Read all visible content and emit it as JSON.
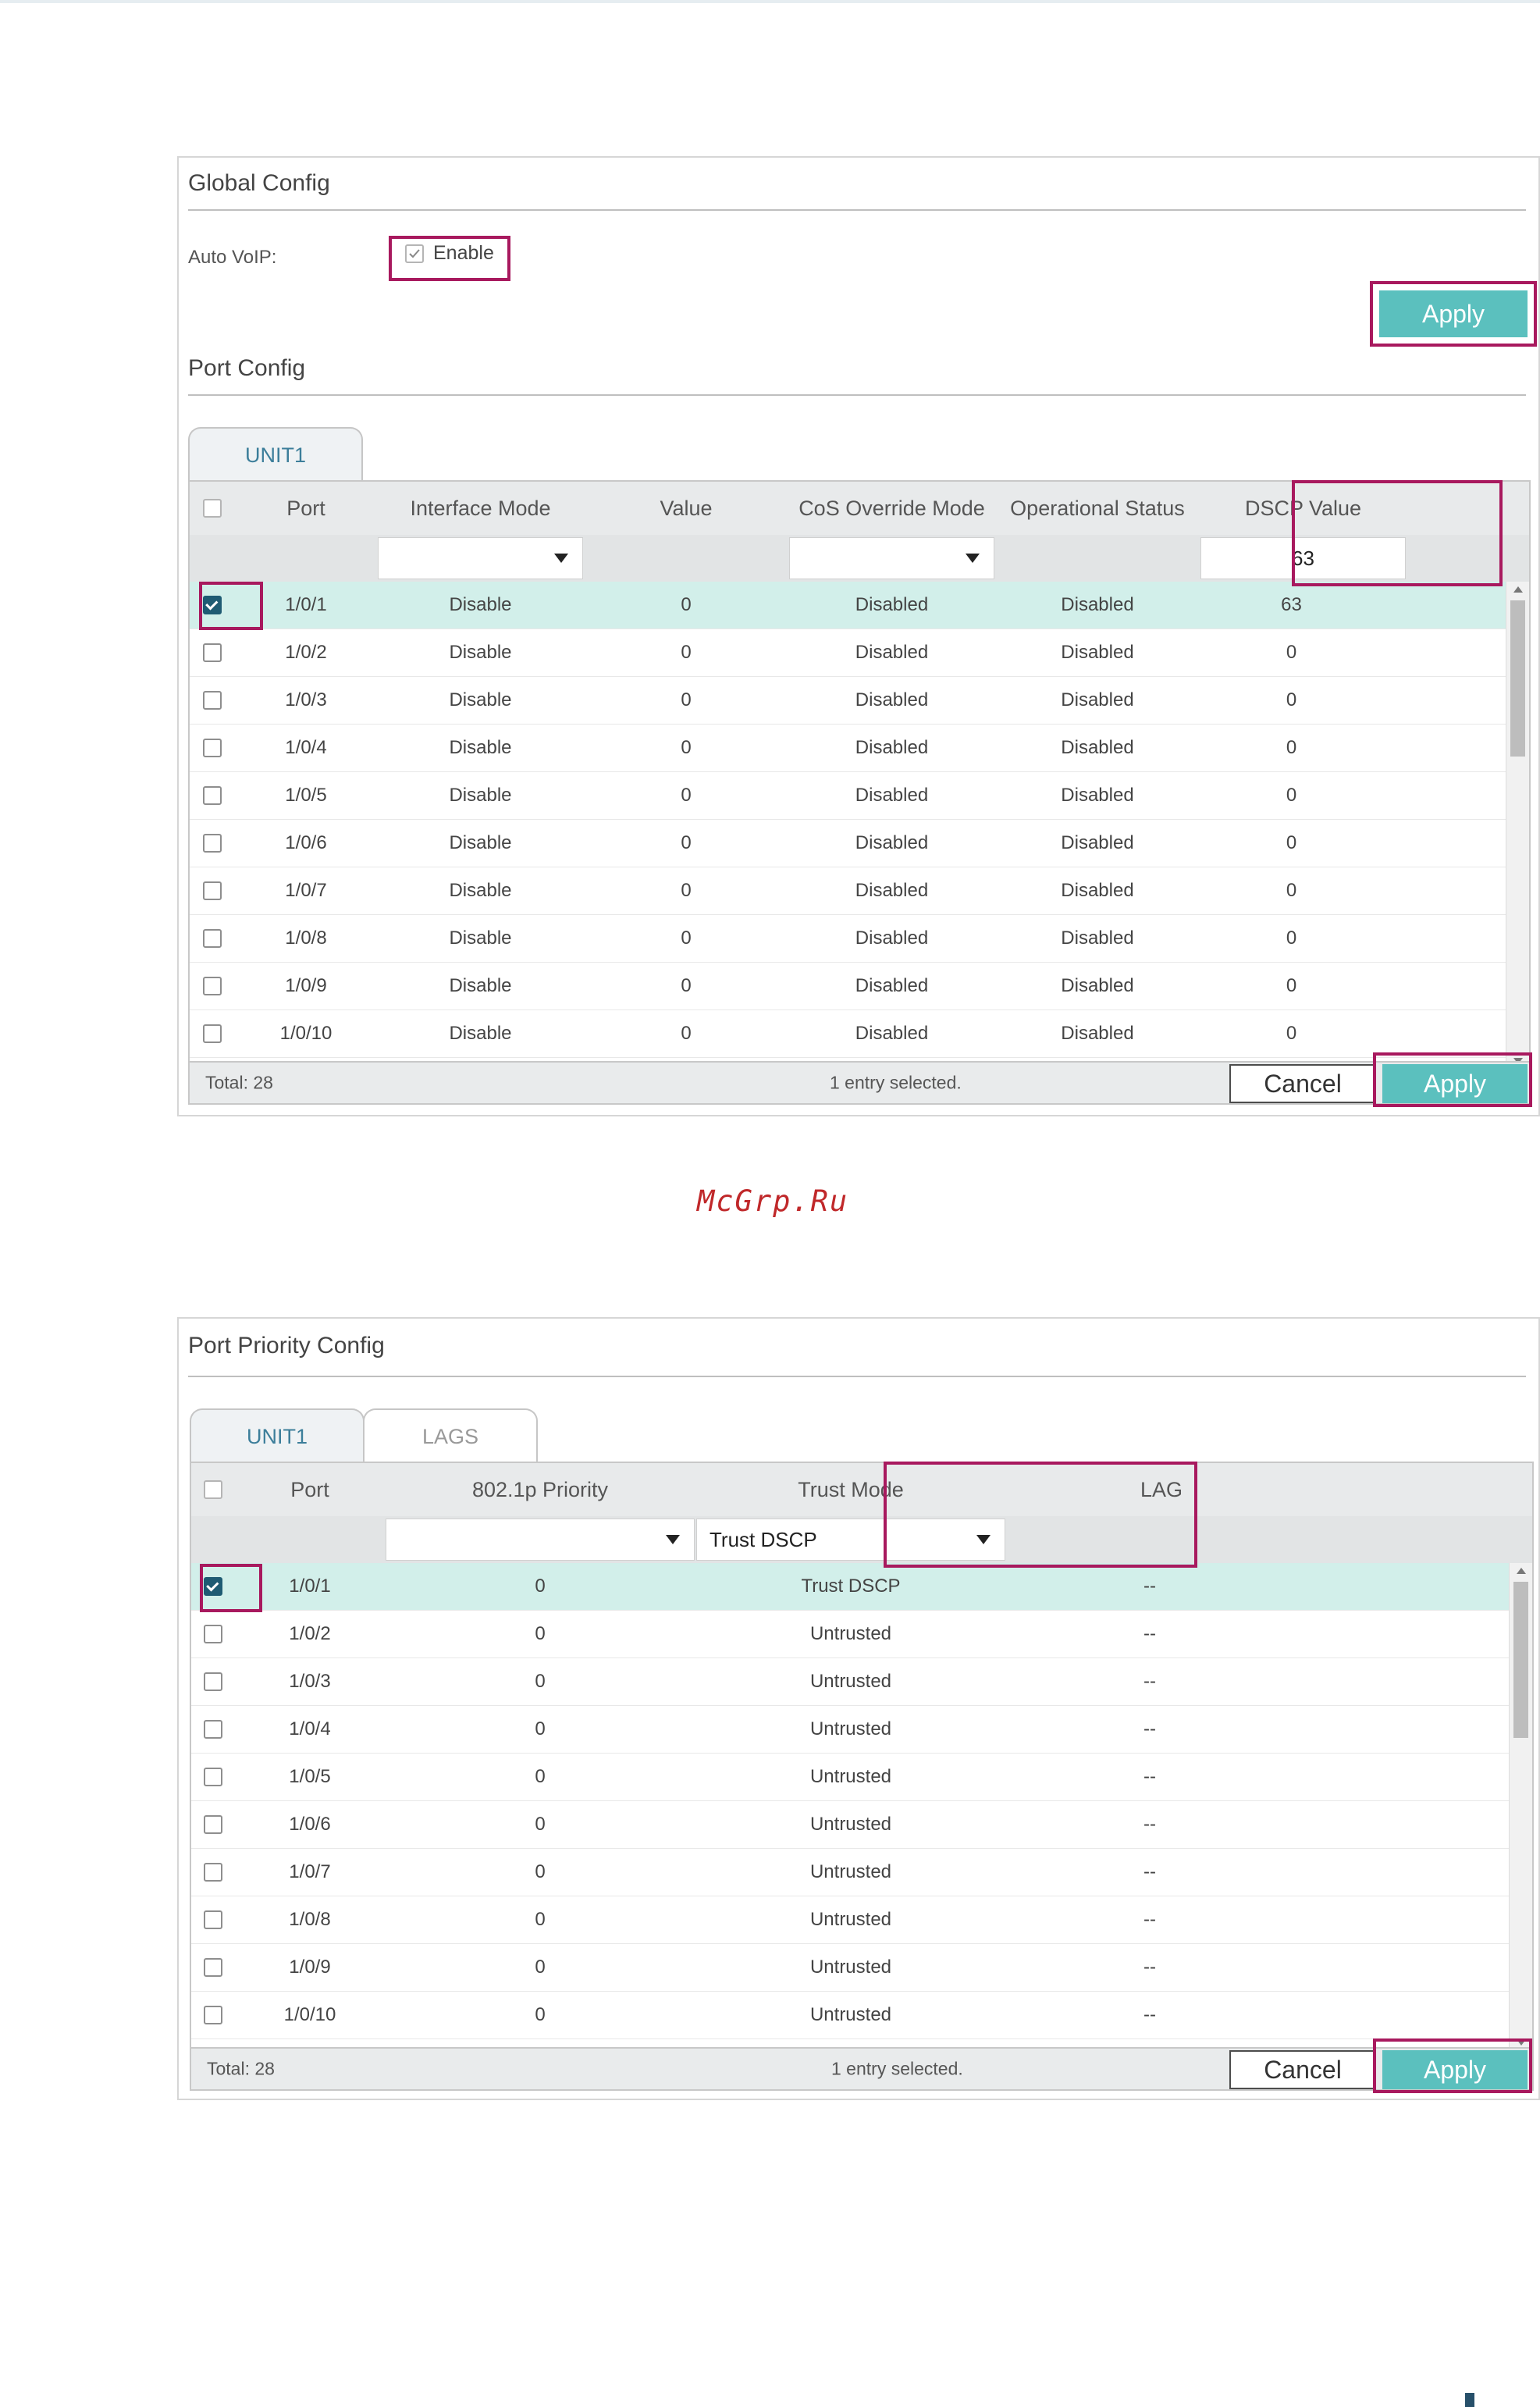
{
  "watermark": "McGrp.Ru",
  "global_config": {
    "title": "Global Config",
    "auto_voip_label": "Auto VoIP:",
    "enable_label": "Enable",
    "enable_checked": true,
    "apply_label": "Apply"
  },
  "port_config": {
    "title": "Port Config",
    "tabs": [
      "UNIT1"
    ],
    "columns": [
      "Port",
      "Interface Mode",
      "Value",
      "CoS Override Mode",
      "Operational Status",
      "DSCP Value"
    ],
    "filter": {
      "interface_mode": "",
      "cos_override_mode": "",
      "dscp_value": "63"
    },
    "rows": [
      {
        "port": "1/0/1",
        "interface_mode": "Disable",
        "value": "0",
        "cos_override_mode": "Disabled",
        "operational_status": "Disabled",
        "dscp_value": "63",
        "selected": true
      },
      {
        "port": "1/0/2",
        "interface_mode": "Disable",
        "value": "0",
        "cos_override_mode": "Disabled",
        "operational_status": "Disabled",
        "dscp_value": "0",
        "selected": false
      },
      {
        "port": "1/0/3",
        "interface_mode": "Disable",
        "value": "0",
        "cos_override_mode": "Disabled",
        "operational_status": "Disabled",
        "dscp_value": "0",
        "selected": false
      },
      {
        "port": "1/0/4",
        "interface_mode": "Disable",
        "value": "0",
        "cos_override_mode": "Disabled",
        "operational_status": "Disabled",
        "dscp_value": "0",
        "selected": false
      },
      {
        "port": "1/0/5",
        "interface_mode": "Disable",
        "value": "0",
        "cos_override_mode": "Disabled",
        "operational_status": "Disabled",
        "dscp_value": "0",
        "selected": false
      },
      {
        "port": "1/0/6",
        "interface_mode": "Disable",
        "value": "0",
        "cos_override_mode": "Disabled",
        "operational_status": "Disabled",
        "dscp_value": "0",
        "selected": false
      },
      {
        "port": "1/0/7",
        "interface_mode": "Disable",
        "value": "0",
        "cos_override_mode": "Disabled",
        "operational_status": "Disabled",
        "dscp_value": "0",
        "selected": false
      },
      {
        "port": "1/0/8",
        "interface_mode": "Disable",
        "value": "0",
        "cos_override_mode": "Disabled",
        "operational_status": "Disabled",
        "dscp_value": "0",
        "selected": false
      },
      {
        "port": "1/0/9",
        "interface_mode": "Disable",
        "value": "0",
        "cos_override_mode": "Disabled",
        "operational_status": "Disabled",
        "dscp_value": "0",
        "selected": false
      },
      {
        "port": "1/0/10",
        "interface_mode": "Disable",
        "value": "0",
        "cos_override_mode": "Disabled",
        "operational_status": "Disabled",
        "dscp_value": "0",
        "selected": false
      }
    ],
    "total": "Total: 28",
    "selection_info": "1 entry selected.",
    "cancel_label": "Cancel",
    "apply_label": "Apply"
  },
  "port_priority_config": {
    "title": "Port Priority Config",
    "tabs": [
      "UNIT1",
      "LAGS"
    ],
    "columns": [
      "Port",
      "802.1p Priority",
      "Trust Mode",
      "LAG"
    ],
    "filter": {
      "priority": "",
      "trust_mode": "Trust DSCP"
    },
    "rows": [
      {
        "port": "1/0/1",
        "priority": "0",
        "trust_mode": "Trust DSCP",
        "lag": "--",
        "selected": true
      },
      {
        "port": "1/0/2",
        "priority": "0",
        "trust_mode": "Untrusted",
        "lag": "--",
        "selected": false
      },
      {
        "port": "1/0/3",
        "priority": "0",
        "trust_mode": "Untrusted",
        "lag": "--",
        "selected": false
      },
      {
        "port": "1/0/4",
        "priority": "0",
        "trust_mode": "Untrusted",
        "lag": "--",
        "selected": false
      },
      {
        "port": "1/0/5",
        "priority": "0",
        "trust_mode": "Untrusted",
        "lag": "--",
        "selected": false
      },
      {
        "port": "1/0/6",
        "priority": "0",
        "trust_mode": "Untrusted",
        "lag": "--",
        "selected": false
      },
      {
        "port": "1/0/7",
        "priority": "0",
        "trust_mode": "Untrusted",
        "lag": "--",
        "selected": false
      },
      {
        "port": "1/0/8",
        "priority": "0",
        "trust_mode": "Untrusted",
        "lag": "--",
        "selected": false
      },
      {
        "port": "1/0/9",
        "priority": "0",
        "trust_mode": "Untrusted",
        "lag": "--",
        "selected": false
      },
      {
        "port": "1/0/10",
        "priority": "0",
        "trust_mode": "Untrusted",
        "lag": "--",
        "selected": false
      }
    ],
    "total": "Total: 28",
    "selection_info": "1 entry selected.",
    "cancel_label": "Cancel",
    "apply_label": "Apply"
  },
  "colors": {
    "accent": "#5bc0be",
    "highlight": "#a8195e",
    "selected_row": "#d2efea",
    "checkbox_checked": "#1f5b73"
  }
}
